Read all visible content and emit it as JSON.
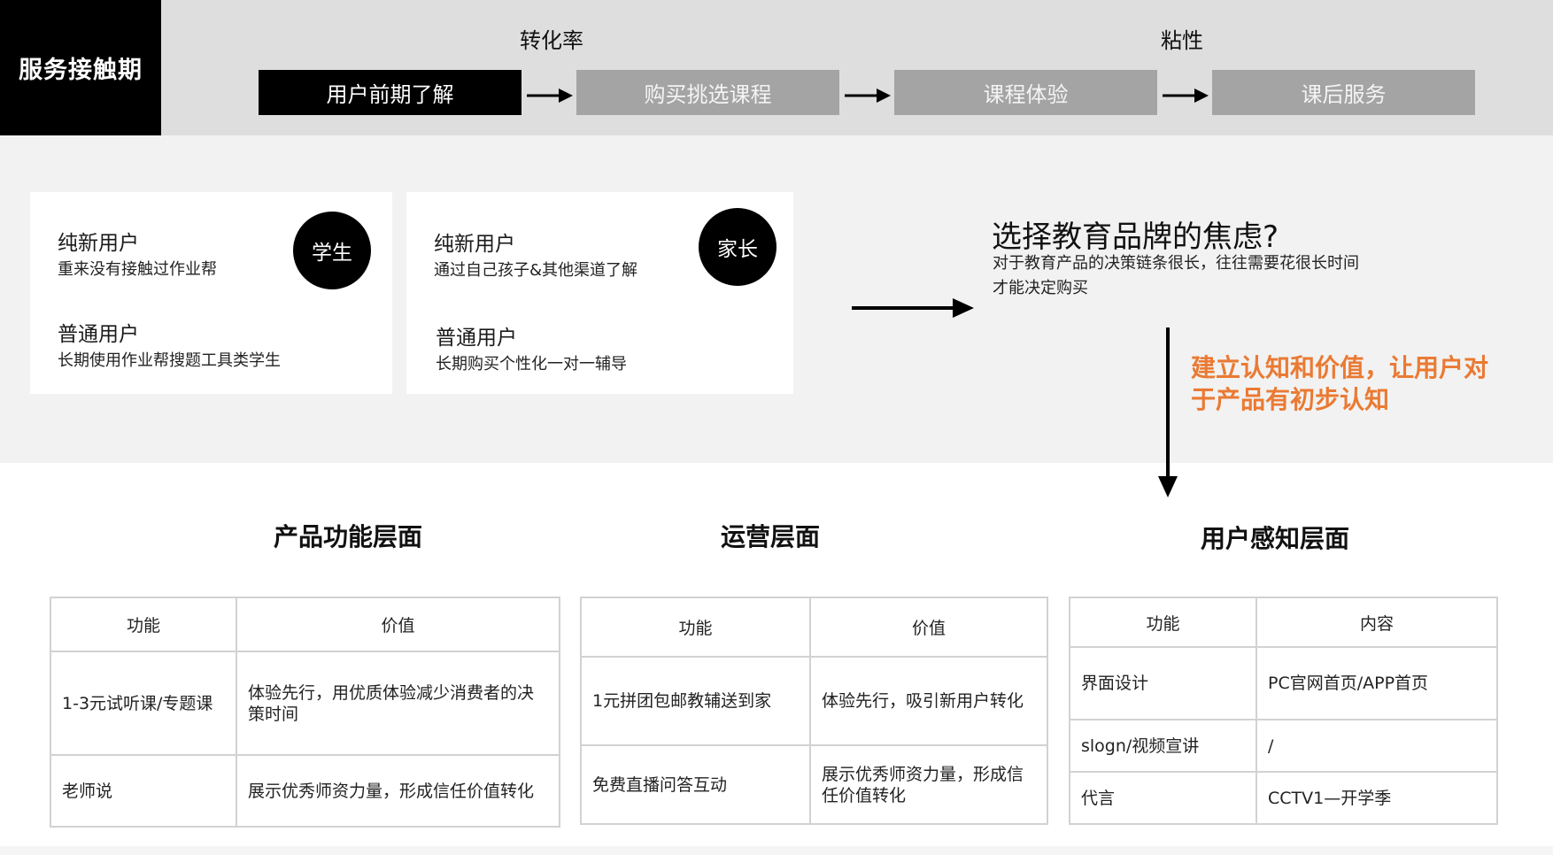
{
  "header": {
    "stage_label": "服务接触期",
    "metrics": [
      "转化率",
      "粘性"
    ],
    "steps": [
      {
        "label": "用户前期了解",
        "active": true
      },
      {
        "label": "购买挑选课程",
        "active": false
      },
      {
        "label": "课程体验",
        "active": false
      },
      {
        "label": "课后服务",
        "active": false
      }
    ]
  },
  "user_cards": [
    {
      "badge": "学生",
      "groups": [
        {
          "title": "纯新用户",
          "desc": "重来没有接触过作业帮"
        },
        {
          "title": "普通用户",
          "desc": "长期使用作业帮搜题工具类学生"
        }
      ]
    },
    {
      "badge": "家长",
      "groups": [
        {
          "title": "纯新用户",
          "desc": "通过自己孩子&其他渠道了解"
        },
        {
          "title": "普通用户",
          "desc": "长期购买个性化一对一辅导"
        }
      ]
    }
  ],
  "insight": {
    "title": "选择教育品牌的焦虑?",
    "desc_line1": "对于教育产品的决策链条很长，往往需要花很长时间",
    "desc_line2": "才能决定购买",
    "goal_line1": "建立认知和价值，让用户对",
    "goal_line2": "于产品有初步认知"
  },
  "layers": {
    "product": {
      "title": "产品功能层面",
      "headers": [
        "功能",
        "价值"
      ],
      "rows": [
        [
          "1-3元试听课/专题课",
          "体验先行，用优质体验减少消费者的决策时间"
        ],
        [
          "老师说",
          "展示优秀师资力量，形成信任价值转化"
        ]
      ]
    },
    "ops": {
      "title": "运营层面",
      "headers": [
        "功能",
        "价值"
      ],
      "rows": [
        [
          "1元拼团包邮教辅送到家",
          "体验先行，吸引新用户转化"
        ],
        [
          "免费直播问答互动",
          "展示优秀师资力量，形成信任价值转化"
        ]
      ]
    },
    "user": {
      "title": "用户感知层面",
      "headers": [
        "功能",
        "内容"
      ],
      "rows": [
        [
          "界面设计",
          "PC官网首页/APP首页"
        ],
        [
          "slogn/视频宣讲",
          "/"
        ],
        [
          "代言",
          "CCTV1—开学季"
        ]
      ]
    }
  },
  "colors": {
    "accent_orange": "#ea7a33",
    "active_step": "#000000",
    "inactive_step": "#a4a4a4",
    "top_band": "#dedede",
    "mid_band": "#f2f2f2"
  }
}
